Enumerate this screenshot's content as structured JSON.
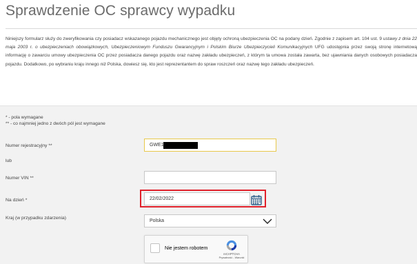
{
  "page": {
    "title": "Sprawdzenie OC sprawcy wypadku",
    "intro": {
      "p1": "Niniejszy formularz służy do zweryfikowania czy posiadacz wskazanego pojazdu mechanicznego jest objęty ochroną ubezpieczenia OC na podany dzień. Zgodnie z zapisem art. 104 ust. 9 ",
      "p2": "ustawy z dnia 22 maja 2003 r. o ubezpieczeniach obowiązkowych, Ubezpieczeniowym Funduszu Gwarancyjnym i Polskim Biurze Ubezpieczycieli Komunikacyjnych",
      "p3": " UFG udostępnia przez swoją stronę internetową informację o zawarciu umowy ubezpieczenia OC przez posiadacza danego pojazdu oraz nazwę zakładu ubezpieczeń, z którym ta umowa została zawarta, bez ujawniania danych osobowych posiadacza pojazdu. Dodatkowo, po wybraniu kraju innego niż Polska, dowiesz się, kto jest reprezentantem do spraw roszczeń oraz nazwę tego zakładu ubezpieczeń."
    }
  },
  "form": {
    "note_required": "* - pola wymagane",
    "note_either": "** - co najmniej jedno z dwóch pól jest wymagane",
    "registration": {
      "label": "Numer rejestracyjny **",
      "value": "GWE14"
    },
    "or_label": "lub",
    "vin": {
      "label": "Numer VIN **",
      "value": ""
    },
    "date": {
      "label": "Na dzień *",
      "value": "22/02/2022"
    },
    "country": {
      "label": "Kraj (w przypadku zdarzenia)",
      "value": "Polska"
    },
    "captcha": {
      "label": "Nie jestem robotem",
      "brand": "reCAPTCHA",
      "links": "Prywatność - Warunki"
    }
  },
  "colors": {
    "highlight": "#e0202a",
    "focus": "#e8c84a",
    "panel": "#f2f2f2",
    "calendar": "#2f5f8a"
  }
}
